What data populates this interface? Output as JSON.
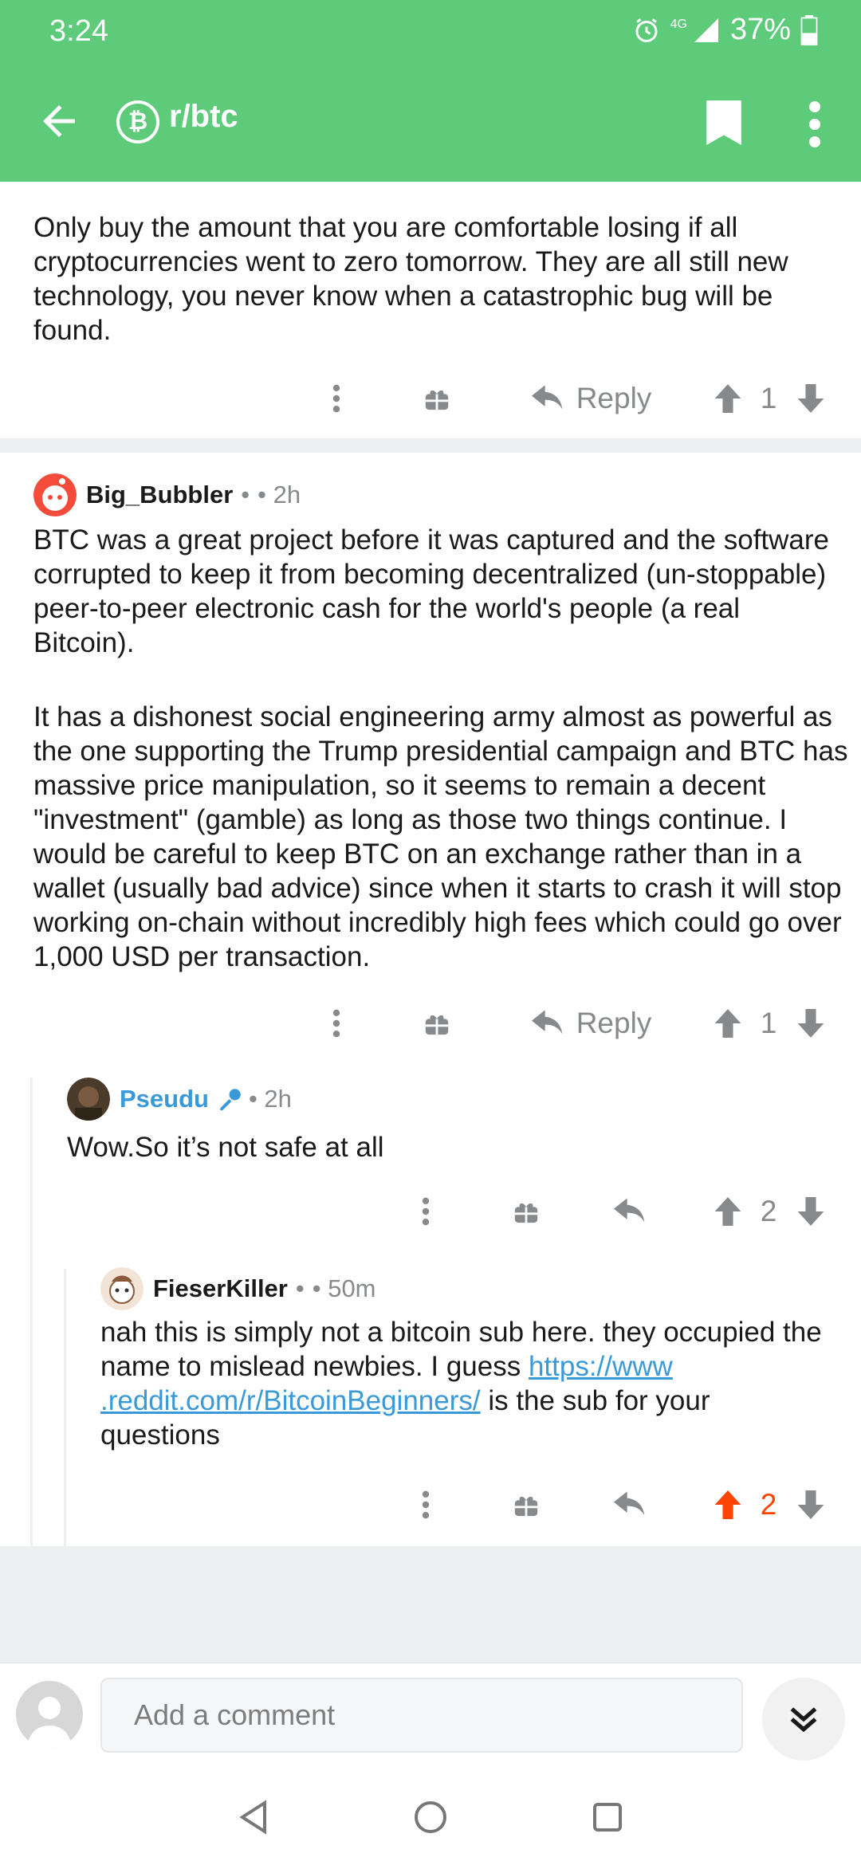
{
  "status_bar": {
    "time": "3:24",
    "network": "4G",
    "battery": "37%"
  },
  "toolbar": {
    "subreddit": "r/btc",
    "sub_badge": "₿"
  },
  "top_comment": {
    "text": "Only buy the amount that you are comfortable losing if all cryptocurrencies went to zero tomorrow. They are all still new technology, you never know when a catastrophic bug will be found.",
    "reply_label": "Reply",
    "score": "1"
  },
  "comment_big": {
    "author": "Big_Bubbler",
    "sep": "•",
    "age": "• 2h",
    "para1": "BTC was a great project before it was captured and the software corrupted to keep it from becoming decentralized (un-stoppable) peer-to-peer electronic cash for the world's people (a real Bitcoin).",
    "para2": "It has a dishonest social engineering army almost as powerful as the one supporting the Trump presidential campaign and BTC has massive price manipulation, so it seems to remain a decent \"investment\" (gamble) as long as those two things continue. I would be careful to keep BTC on an exchange rather than in a wallet (usually bad advice) since when it starts to crash it will stop working on-chain without incredibly high fees which could go over 1,000 USD per transaction.",
    "reply_label": "Reply",
    "score": "1"
  },
  "comment_pseudu": {
    "author": "Pseudu",
    "age": "• 2h",
    "text": "Wow.So it’s not safe at all",
    "score": "2"
  },
  "comment_fieser": {
    "author": "FieserKiller",
    "sep": "•",
    "age": "• 50m",
    "text_before": "nah this is simply not a bitcoin sub here. they occupied the name to mislead newbies. I guess ",
    "link_line1": "https://www",
    "link_line2": ".reddit.com/r/BitcoinBeginners/",
    "text_after": " is the sub for your questions",
    "score": "2"
  },
  "composer": {
    "placeholder": "Add a comment"
  },
  "colors": {
    "brand_green": "#5ecb7b",
    "upvoted": "#ff4500",
    "link": "#3a9ad9"
  }
}
